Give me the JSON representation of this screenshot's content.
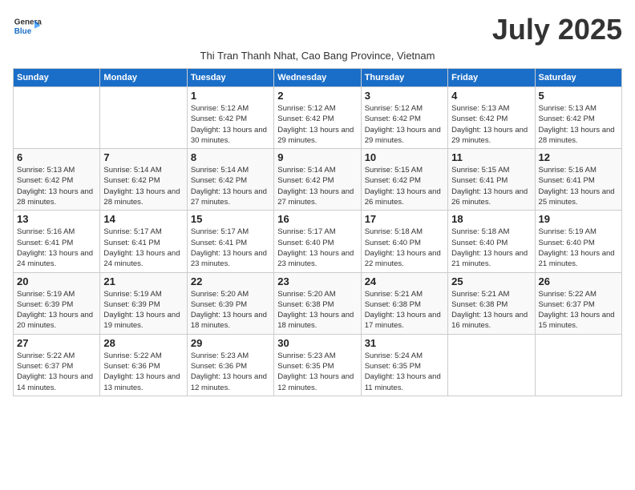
{
  "header": {
    "logo_line1": "General",
    "logo_line2": "Blue",
    "month_title": "July 2025",
    "subtitle": "Thi Tran Thanh Nhat, Cao Bang Province, Vietnam"
  },
  "weekdays": [
    "Sunday",
    "Monday",
    "Tuesday",
    "Wednesday",
    "Thursday",
    "Friday",
    "Saturday"
  ],
  "weeks": [
    [
      {
        "day": "",
        "info": ""
      },
      {
        "day": "",
        "info": ""
      },
      {
        "day": "1",
        "info": "Sunrise: 5:12 AM\nSunset: 6:42 PM\nDaylight: 13 hours and 30 minutes."
      },
      {
        "day": "2",
        "info": "Sunrise: 5:12 AM\nSunset: 6:42 PM\nDaylight: 13 hours and 29 minutes."
      },
      {
        "day": "3",
        "info": "Sunrise: 5:12 AM\nSunset: 6:42 PM\nDaylight: 13 hours and 29 minutes."
      },
      {
        "day": "4",
        "info": "Sunrise: 5:13 AM\nSunset: 6:42 PM\nDaylight: 13 hours and 29 minutes."
      },
      {
        "day": "5",
        "info": "Sunrise: 5:13 AM\nSunset: 6:42 PM\nDaylight: 13 hours and 28 minutes."
      }
    ],
    [
      {
        "day": "6",
        "info": "Sunrise: 5:13 AM\nSunset: 6:42 PM\nDaylight: 13 hours and 28 minutes."
      },
      {
        "day": "7",
        "info": "Sunrise: 5:14 AM\nSunset: 6:42 PM\nDaylight: 13 hours and 28 minutes."
      },
      {
        "day": "8",
        "info": "Sunrise: 5:14 AM\nSunset: 6:42 PM\nDaylight: 13 hours and 27 minutes."
      },
      {
        "day": "9",
        "info": "Sunrise: 5:14 AM\nSunset: 6:42 PM\nDaylight: 13 hours and 27 minutes."
      },
      {
        "day": "10",
        "info": "Sunrise: 5:15 AM\nSunset: 6:42 PM\nDaylight: 13 hours and 26 minutes."
      },
      {
        "day": "11",
        "info": "Sunrise: 5:15 AM\nSunset: 6:41 PM\nDaylight: 13 hours and 26 minutes."
      },
      {
        "day": "12",
        "info": "Sunrise: 5:16 AM\nSunset: 6:41 PM\nDaylight: 13 hours and 25 minutes."
      }
    ],
    [
      {
        "day": "13",
        "info": "Sunrise: 5:16 AM\nSunset: 6:41 PM\nDaylight: 13 hours and 24 minutes."
      },
      {
        "day": "14",
        "info": "Sunrise: 5:17 AM\nSunset: 6:41 PM\nDaylight: 13 hours and 24 minutes."
      },
      {
        "day": "15",
        "info": "Sunrise: 5:17 AM\nSunset: 6:41 PM\nDaylight: 13 hours and 23 minutes."
      },
      {
        "day": "16",
        "info": "Sunrise: 5:17 AM\nSunset: 6:40 PM\nDaylight: 13 hours and 23 minutes."
      },
      {
        "day": "17",
        "info": "Sunrise: 5:18 AM\nSunset: 6:40 PM\nDaylight: 13 hours and 22 minutes."
      },
      {
        "day": "18",
        "info": "Sunrise: 5:18 AM\nSunset: 6:40 PM\nDaylight: 13 hours and 21 minutes."
      },
      {
        "day": "19",
        "info": "Sunrise: 5:19 AM\nSunset: 6:40 PM\nDaylight: 13 hours and 21 minutes."
      }
    ],
    [
      {
        "day": "20",
        "info": "Sunrise: 5:19 AM\nSunset: 6:39 PM\nDaylight: 13 hours and 20 minutes."
      },
      {
        "day": "21",
        "info": "Sunrise: 5:19 AM\nSunset: 6:39 PM\nDaylight: 13 hours and 19 minutes."
      },
      {
        "day": "22",
        "info": "Sunrise: 5:20 AM\nSunset: 6:39 PM\nDaylight: 13 hours and 18 minutes."
      },
      {
        "day": "23",
        "info": "Sunrise: 5:20 AM\nSunset: 6:38 PM\nDaylight: 13 hours and 18 minutes."
      },
      {
        "day": "24",
        "info": "Sunrise: 5:21 AM\nSunset: 6:38 PM\nDaylight: 13 hours and 17 minutes."
      },
      {
        "day": "25",
        "info": "Sunrise: 5:21 AM\nSunset: 6:38 PM\nDaylight: 13 hours and 16 minutes."
      },
      {
        "day": "26",
        "info": "Sunrise: 5:22 AM\nSunset: 6:37 PM\nDaylight: 13 hours and 15 minutes."
      }
    ],
    [
      {
        "day": "27",
        "info": "Sunrise: 5:22 AM\nSunset: 6:37 PM\nDaylight: 13 hours and 14 minutes."
      },
      {
        "day": "28",
        "info": "Sunrise: 5:22 AM\nSunset: 6:36 PM\nDaylight: 13 hours and 13 minutes."
      },
      {
        "day": "29",
        "info": "Sunrise: 5:23 AM\nSunset: 6:36 PM\nDaylight: 13 hours and 12 minutes."
      },
      {
        "day": "30",
        "info": "Sunrise: 5:23 AM\nSunset: 6:35 PM\nDaylight: 13 hours and 12 minutes."
      },
      {
        "day": "31",
        "info": "Sunrise: 5:24 AM\nSunset: 6:35 PM\nDaylight: 13 hours and 11 minutes."
      },
      {
        "day": "",
        "info": ""
      },
      {
        "day": "",
        "info": ""
      }
    ]
  ]
}
